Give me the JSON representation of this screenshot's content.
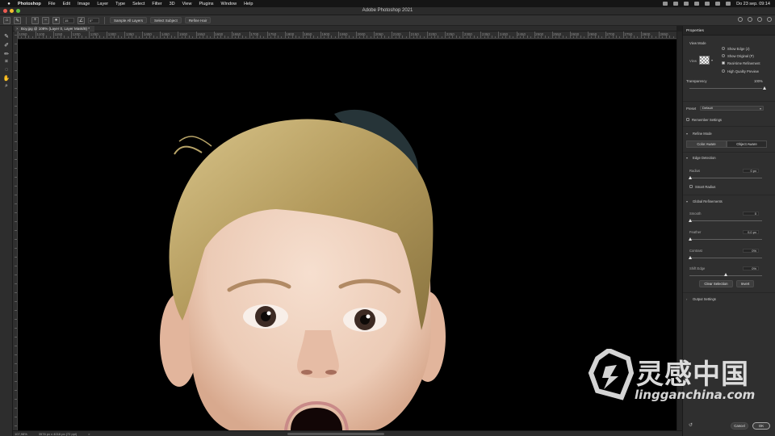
{
  "menubar": {
    "items": [
      "Photoshop",
      "File",
      "Edit",
      "Image",
      "Layer",
      "Type",
      "Select",
      "Filter",
      "3D",
      "View",
      "Plugins",
      "Window",
      "Help"
    ],
    "clock": "Do 23 sep.  09:14"
  },
  "window": {
    "title": "Adobe Photoshop 2021"
  },
  "options_bar": {
    "size_value": "15",
    "radius_value": "0°",
    "sample_all_layers": "Sample All Layers",
    "select_subject": "Select Subject",
    "refine_hair": "Refine Hair"
  },
  "document_tab": {
    "label": "Boy.jpg @ 108% (Layer 0, Layer Mask/8) *",
    "close_glyph": "×"
  },
  "ruler": {
    "top_labels": [
      "1050",
      "1100",
      "1150",
      "1200",
      "1250",
      "1300",
      "1350",
      "1400",
      "1450",
      "1500",
      "1550",
      "1600",
      "1650",
      "1700",
      "1750",
      "1800",
      "1850",
      "1900",
      "1950",
      "2000",
      "2050",
      "2100",
      "2150",
      "2200",
      "2250",
      "2300",
      "2350",
      "2400",
      "2450",
      "2500",
      "2550",
      "2600",
      "2650",
      "2700",
      "2750",
      "2800",
      "2850"
    ]
  },
  "status_bar": {
    "zoom": "107,98%",
    "doc_size": "3576 px x 4016 px (72 ppi)",
    "arrow": ">"
  },
  "properties": {
    "title": "Properties",
    "view_mode": {
      "section_label": "View Mode",
      "view_label": "View",
      "show_edge": "Show Edge (J)",
      "show_original": "Show Original (P)",
      "realtime_refinement": "Real-time Refinement",
      "high_quality_preview": "High Quality Preview",
      "realtime_checked": true
    },
    "transparency": {
      "label": "Transparency",
      "value": "100%",
      "fraction": 1.0
    },
    "preset": {
      "label": "Preset",
      "value": "Default"
    },
    "remember_settings": "Remember Settings",
    "refine_mode": {
      "label": "Refine Mode",
      "color_aware": "Color Aware",
      "object_aware": "Object Aware",
      "selected": "Color Aware"
    },
    "edge_detection": {
      "label": "Edge Detection",
      "radius_label": "Radius",
      "radius_value": "0 px",
      "radius_fraction": 0.0,
      "smart_radius": "Smart Radius"
    },
    "global_refinements": {
      "label": "Global Refinements",
      "smooth_label": "Smooth",
      "smooth_value": "0",
      "smooth_fraction": 0.0,
      "feather_label": "Feather",
      "feather_value": "0,0 px",
      "feather_fraction": 0.0,
      "contrast_label": "Contrast",
      "contrast_value": "0%",
      "contrast_fraction": 0.0,
      "shift_edge_label": "Shift Edge",
      "shift_edge_value": "0%",
      "shift_edge_fraction": 0.5
    },
    "clear_selection": "Clear Selection",
    "invert": "Invert",
    "output_settings": "Output Settings",
    "cancel": "Cancel",
    "ok": "OK"
  },
  "watermark": {
    "chinese": "灵感中国",
    "url": "lingganchina.com"
  },
  "colors": {
    "canvas_bg": "#000000",
    "panel_bg": "#2f2f2f",
    "hair": "#b8a468",
    "skin": "#f0d2bd"
  },
  "icons": [
    "apple-icon",
    "brush-icon",
    "lasso-icon",
    "hand-icon",
    "zoom-icon",
    "search-icon",
    "share-icon",
    "reset-icon"
  ]
}
